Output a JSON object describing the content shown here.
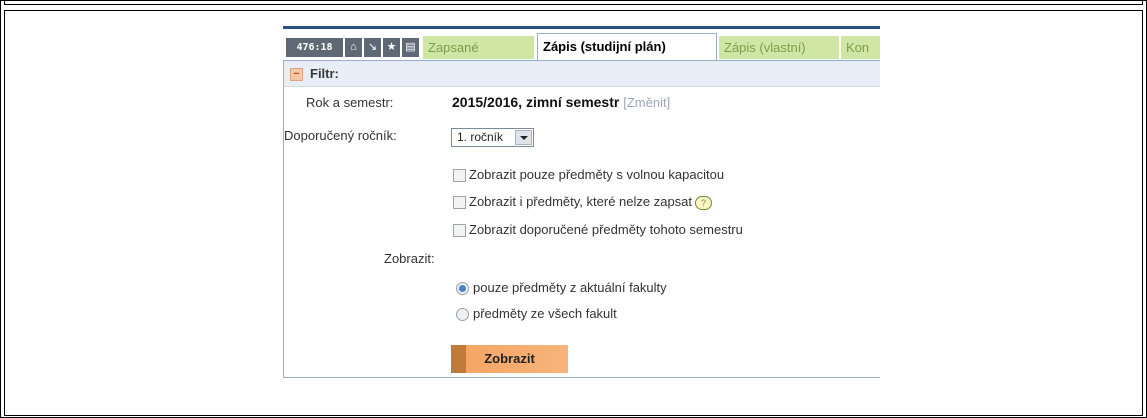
{
  "toolbar": {
    "counter": "476:18",
    "icons": [
      "home-icon",
      "download-icon",
      "star-icon",
      "print-icon"
    ]
  },
  "tabs": [
    {
      "label": "Zapsané",
      "active": false
    },
    {
      "label": "Zápis (studijní plán)",
      "active": true
    },
    {
      "label": "Zápis (vlastní)",
      "active": false
    },
    {
      "label": "Kon",
      "active": false
    }
  ],
  "filter": {
    "title": "Filtr:",
    "rok_label": "Rok a semestr:",
    "rok_value": "2015/2016, zimní semestr",
    "zmenit_link": "[Změnit]",
    "rocnik_label": "Doporučený ročník:",
    "rocnik_value": "1. ročník",
    "checkboxes": [
      {
        "label": "Zobrazit pouze předměty s volnou kapacitou",
        "checked": false
      },
      {
        "label": "Zobrazit i předměty, které nelze zapsat",
        "checked": false
      },
      {
        "label": "Zobrazit doporučené předměty tohoto semestru",
        "checked": false
      }
    ],
    "help_icon_glyph": "?",
    "zobrazit_label": "Zobrazit:",
    "radios": [
      {
        "label": "pouze předměty z aktuální fakulty",
        "checked": true
      },
      {
        "label": "předměty ze všech fakult",
        "checked": false
      }
    ],
    "submit_label": "Zobrazit"
  },
  "colors": {
    "tab_inactive_bg": "#d0e6a5",
    "tab_inactive_text": "#7c9f4d",
    "panel_header_bg": "#e8eef6",
    "button_orange": "#f5a665",
    "counter_bg": "#5f6975"
  }
}
